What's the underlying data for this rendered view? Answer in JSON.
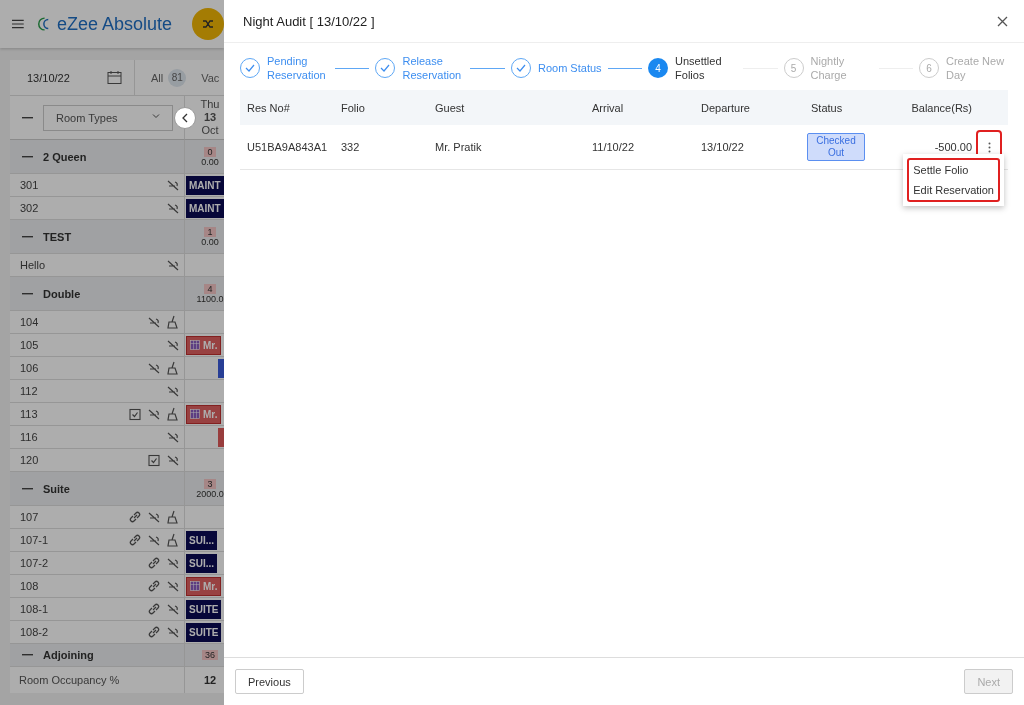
{
  "app": {
    "title": "eZee Absolute",
    "date": "13/10/22",
    "filter_label": "All",
    "filter_count": "81",
    "filter_next": "Vac",
    "room_types_select": "Room Types",
    "day": {
      "weekday": "Thu",
      "date": "13",
      "month": "Oct"
    },
    "groups": [
      {
        "name": "2 Queen",
        "count": "0",
        "amount": "0.00",
        "rooms": [
          {
            "number": "301",
            "linked": false,
            "inspected": false,
            "dirty": false,
            "block": {
              "kind": "label",
              "label": "MAINT"
            }
          },
          {
            "number": "302",
            "linked": false,
            "inspected": false,
            "dirty": false,
            "block": {
              "kind": "label",
              "label": "MAINT"
            }
          }
        ]
      },
      {
        "name": "TEST",
        "count": "1",
        "amount": "0.00",
        "rooms": [
          {
            "number": "Hello",
            "linked": false,
            "inspected": false,
            "dirty": false
          }
        ]
      },
      {
        "name": "Double",
        "count": "4",
        "amount": "1100.0",
        "rooms": [
          {
            "number": "104",
            "linked": false,
            "inspected": false,
            "dirty": true
          },
          {
            "number": "105",
            "linked": false,
            "inspected": false,
            "dirty": false,
            "block": {
              "kind": "booking",
              "label": "Mr."
            }
          },
          {
            "number": "106",
            "linked": false,
            "inspected": false,
            "dirty": true,
            "block": {
              "kind": "stub",
              "color": "#283e95"
            }
          },
          {
            "number": "112",
            "linked": false,
            "inspected": false,
            "dirty": false
          },
          {
            "number": "113",
            "linked": false,
            "inspected": true,
            "dirty": true,
            "block": {
              "kind": "booking",
              "label": "Mr."
            }
          },
          {
            "number": "116",
            "linked": false,
            "inspected": false,
            "dirty": false,
            "block": {
              "kind": "stub",
              "color": "#983d3d"
            }
          },
          {
            "number": "120",
            "linked": false,
            "inspected": true,
            "dirty": false
          }
        ]
      },
      {
        "name": "Suite",
        "count": "3",
        "amount": "2000.0",
        "rooms": [
          {
            "number": "107",
            "linked": true,
            "inspected": false,
            "dirty": true
          },
          {
            "number": "107-1",
            "linked": true,
            "inspected": false,
            "dirty": true,
            "block": {
              "kind": "label",
              "label": "SUI..."
            }
          },
          {
            "number": "107-2",
            "linked": true,
            "inspected": false,
            "dirty": false,
            "block": {
              "kind": "label",
              "label": "SUI..."
            }
          },
          {
            "number": "108",
            "linked": true,
            "inspected": false,
            "dirty": false,
            "block": {
              "kind": "booking",
              "label": "Mr."
            }
          },
          {
            "number": "108-1",
            "linked": true,
            "inspected": false,
            "dirty": false,
            "block": {
              "kind": "label",
              "label": "SUITE"
            }
          },
          {
            "number": "108-2",
            "linked": true,
            "inspected": false,
            "dirty": false,
            "block": {
              "kind": "label",
              "label": "SUITE"
            }
          }
        ]
      },
      {
        "name": "Adjoining",
        "count": "36"
      }
    ],
    "footer": {
      "label": "Room Occupancy %",
      "value": "12"
    }
  },
  "dialog": {
    "title": "Night Audit [ 13/10/22 ]",
    "steps": [
      {
        "label": "Pending Reservation",
        "completed": true,
        "active": false
      },
      {
        "label": "Release Reservation",
        "completed": true,
        "active": false
      },
      {
        "label": "Room Status",
        "completed": true,
        "active": false
      },
      {
        "label": "Unsettled Folios",
        "number": "4",
        "completed": false,
        "active": true
      },
      {
        "label": "Nightly Charge",
        "number": "5",
        "completed": false,
        "active": false
      },
      {
        "label": "Create New Day",
        "number": "6",
        "completed": false,
        "active": false
      }
    ],
    "table": {
      "columns": [
        "Res No#",
        "Folio",
        "Guest",
        "Arrival",
        "Departure",
        "Status",
        "Balance(Rs)"
      ],
      "rows": [
        {
          "res_no": "U51BA9A843A1",
          "folio": "332",
          "guest": "Mr. Pratik",
          "arrival": "11/10/22",
          "departure": "13/10/22",
          "status": "Checked Out",
          "balance": "-500.00",
          "menu_highlighted": true
        }
      ]
    },
    "menu": {
      "highlighted": true,
      "items": [
        "Settle Folio",
        "Edit Reservation"
      ]
    },
    "buttons": [
      {
        "label": "Previous",
        "disabled": false
      },
      {
        "label": "Next",
        "disabled": true
      }
    ]
  }
}
